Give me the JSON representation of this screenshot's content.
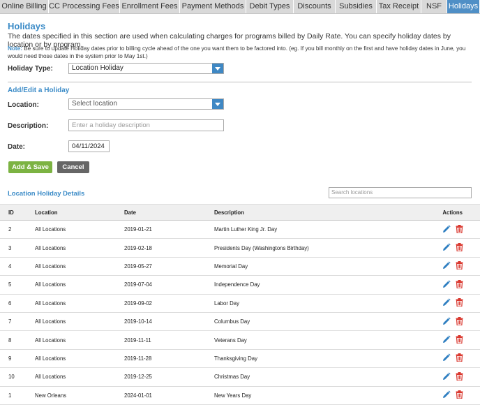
{
  "tabs": [
    {
      "label": "Online Billing"
    },
    {
      "label": "CC Processing Fees"
    },
    {
      "label": "Enrollment Fees"
    },
    {
      "label": "Payment Methods"
    },
    {
      "label": "Debit Types"
    },
    {
      "label": "Discounts"
    },
    {
      "label": "Subsidies"
    },
    {
      "label": "Tax Receipt"
    },
    {
      "label": "NSF"
    },
    {
      "label": "Holidays"
    }
  ],
  "page": {
    "title": "Holidays",
    "intro": "The dates specified in this section are used when calculating charges for programs billed by Daily Rate. You can specify holiday dates by location or by program.",
    "note_label": "Note:",
    "note_text": " Be sure to update Holiday dates prior to billing cycle ahead of the one you want them to be factored into. (eg. If you bill monthly on the first and have holiday dates in June, you would need those dates in the system prior to May 1st.)"
  },
  "holiday_type": {
    "label": "Holiday Type:",
    "value": "Location Holiday"
  },
  "form": {
    "title": "Add/Edit a Holiday",
    "location_label": "Location:",
    "location_placeholder": "Select location",
    "description_label": "Description:",
    "description_placeholder": "Enter a holiday description",
    "date_label": "Date:",
    "date_value": "04/11/2024",
    "add_label": "Add & Save",
    "cancel_label": "Cancel"
  },
  "details": {
    "title": "Location Holiday Details",
    "search_placeholder": "Search locations",
    "columns": {
      "id": "ID",
      "location": "Location",
      "date": "Date",
      "description": "Description",
      "actions": "Actions"
    },
    "rows": [
      {
        "id": "2",
        "location": "All Locations",
        "date": "2019-01-21",
        "description": "Martin Luther King Jr. Day"
      },
      {
        "id": "3",
        "location": "All Locations",
        "date": "2019-02-18",
        "description": "Presidents Day (Washingtons Birthday)"
      },
      {
        "id": "4",
        "location": "All Locations",
        "date": "2019-05-27",
        "description": "Memorial Day"
      },
      {
        "id": "5",
        "location": "All Locations",
        "date": "2019-07-04",
        "description": "Independence Day"
      },
      {
        "id": "6",
        "location": "All Locations",
        "date": "2019-09-02",
        "description": "Labor Day"
      },
      {
        "id": "7",
        "location": "All Locations",
        "date": "2019-10-14",
        "description": "Columbus Day"
      },
      {
        "id": "8",
        "location": "All Locations",
        "date": "2019-11-11",
        "description": "Veterans Day"
      },
      {
        "id": "9",
        "location": "All Locations",
        "date": "2019-11-28",
        "description": "Thanksgiving Day"
      },
      {
        "id": "10",
        "location": "All Locations",
        "date": "2019-12-25",
        "description": "Christmas Day"
      },
      {
        "id": "1",
        "location": "New Orleans",
        "date": "2024-01-01",
        "description": "New Years Day"
      }
    ]
  },
  "colors": {
    "accent": "#3b8bc7",
    "tab_active": "#4f8fc6",
    "add_button": "#7cb342",
    "cancel_button": "#666666",
    "edit_icon": "#2f7fc1",
    "delete_icon": "#d9342b"
  },
  "icons": {
    "edit": "pencil-icon",
    "delete": "trash-icon",
    "dropdown": "chevron-down-icon"
  }
}
